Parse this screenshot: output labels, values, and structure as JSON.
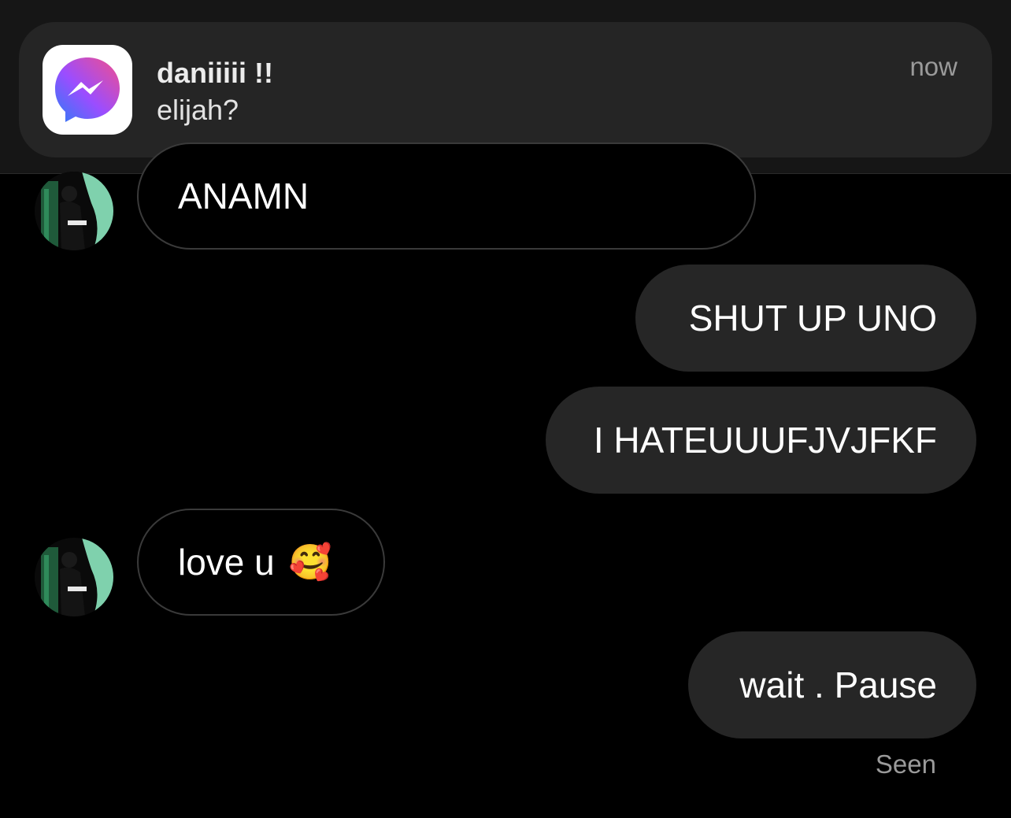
{
  "notification": {
    "sender": "daniiiii !!",
    "message": "elijah?",
    "time": "now",
    "app_icon": "messenger-icon"
  },
  "conversation": {
    "messages": [
      {
        "direction": "incoming",
        "text": "ANAMN"
      },
      {
        "direction": "outgoing",
        "text": "SHUT UP UNO"
      },
      {
        "direction": "outgoing",
        "text": "I HATEUUUFJVJFKF"
      },
      {
        "direction": "incoming",
        "text": "love u",
        "emoji": "🥰"
      },
      {
        "direction": "outgoing",
        "text": "wait . Pause"
      }
    ],
    "status": "Seen"
  },
  "colors": {
    "background": "#000000",
    "outgoing_bubble": "#262626",
    "incoming_bubble_border": "#3a3a3a",
    "notification_background": "#252525",
    "messenger_gradient_start": "#2e7cf6",
    "messenger_gradient_end": "#f24e8c"
  }
}
